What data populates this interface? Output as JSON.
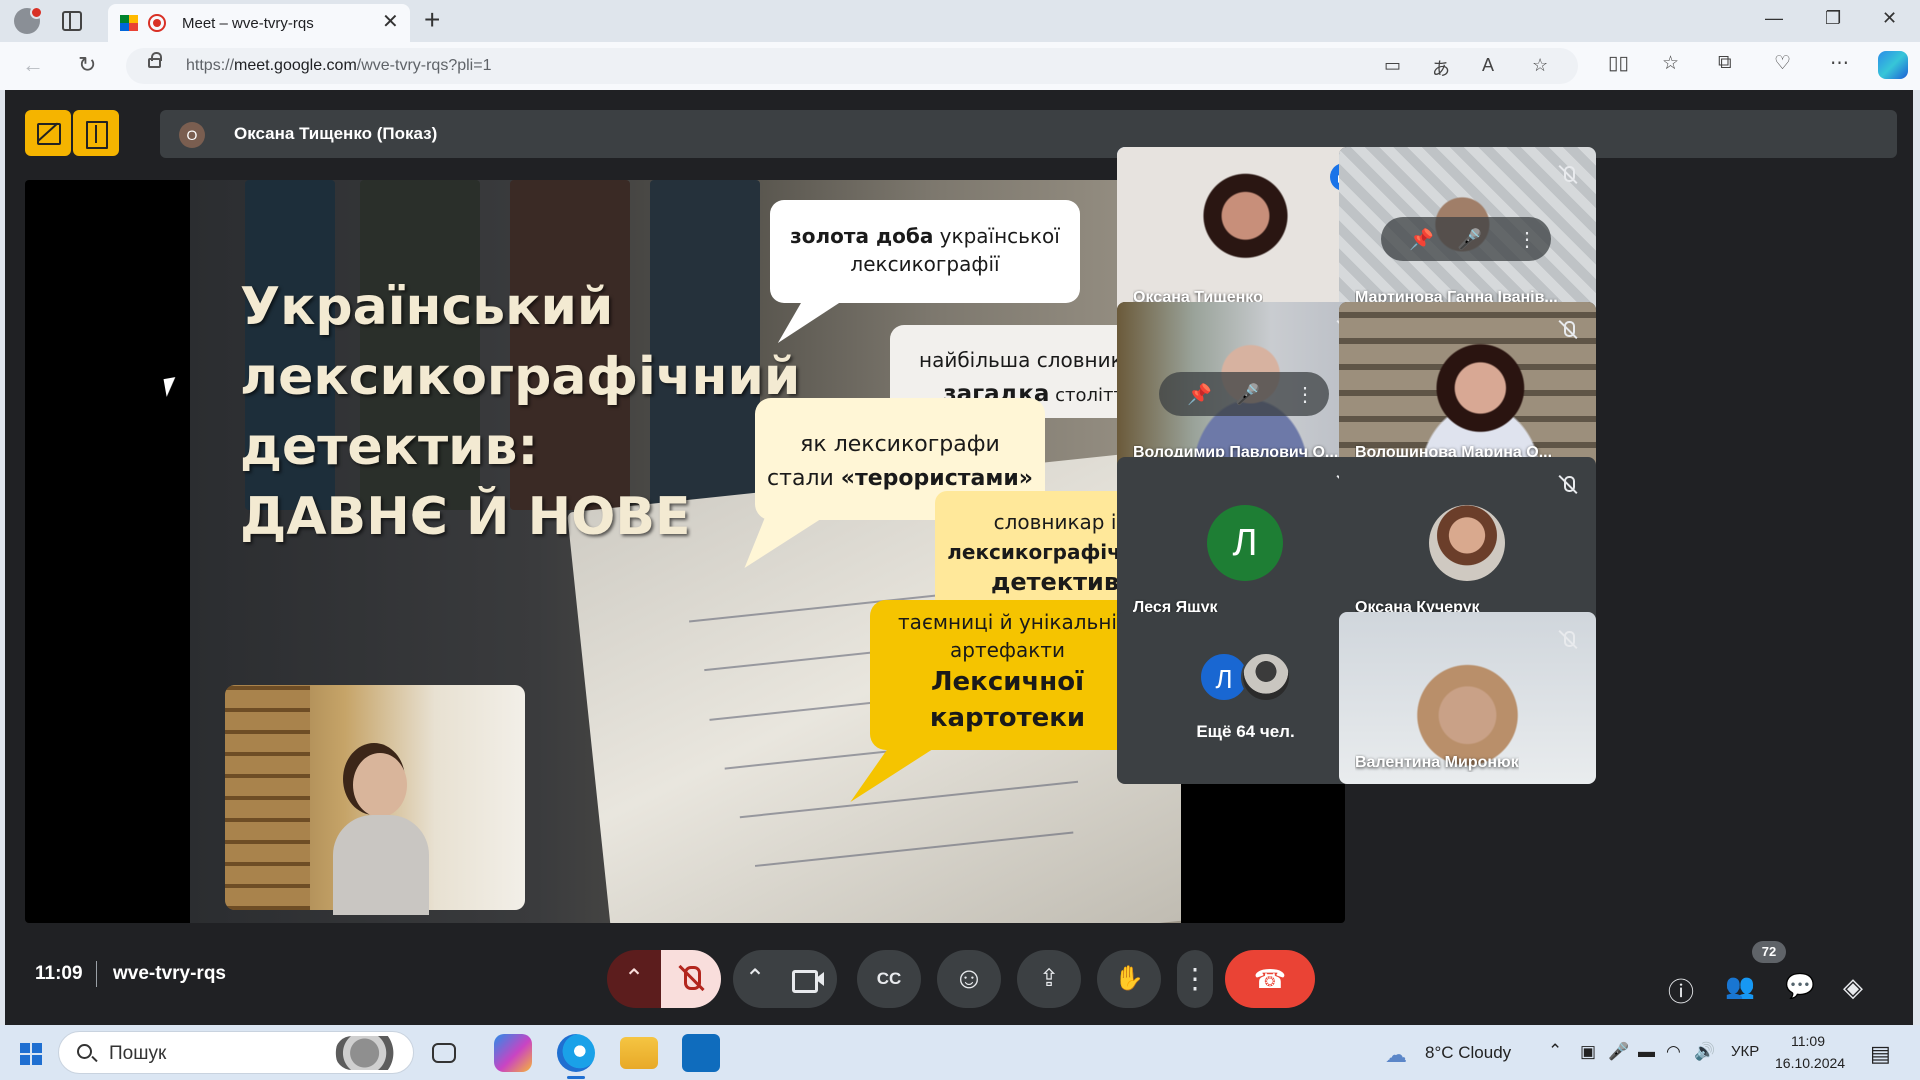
{
  "browser": {
    "tab_title": "Meet – wve-tvry-rqs",
    "tab_close_glyph": "✕",
    "new_tab_glyph": "+",
    "window_controls": [
      "—",
      "❐",
      "✕"
    ],
    "url_prefix": "https://",
    "url_host": "meet.google.com",
    "url_path": "/wve-tvry-rqs?pli=1",
    "nav": {
      "back": "←",
      "reload": "↻"
    },
    "toolbar_icons": [
      "camera-icon",
      "translate-icon",
      "read-aloud-icon",
      "favorite-star-icon",
      "split-screen-icon",
      "favorites-icon",
      "collections-icon",
      "browser-essentials-icon",
      "more-icon",
      "copilot-icon"
    ]
  },
  "meet": {
    "presenter_initial": "О",
    "presenter_label": "Оксана Тищенко (Показ)",
    "slide": {
      "title_lines": [
        "Український",
        "лексикографічний",
        "детектив:",
        "ДАВНЄ Й НОВЕ"
      ],
      "bubble1": {
        "bold": "золота доба",
        "rest1": " української",
        "line2": "лексикографії"
      },
      "bubble2": {
        "line1": "найбільша словникова",
        "bold": "загадка",
        "rest": " століття"
      },
      "bubble3": {
        "line1": "як лексикографи",
        "line2a": "стали ",
        "bold": "«терористами»"
      },
      "bubble4": {
        "line1": "словникар   і",
        "bold1": "лексикографічний",
        "bold2": "детектив"
      },
      "bubble5": {
        "line1": "таємниці й унікальні",
        "line2": "артефакти",
        "bold1": "Лексичної",
        "bold2": "картотеки"
      }
    },
    "tiles": [
      {
        "name": "Оксана Тищенко",
        "state": "speaking"
      },
      {
        "name": "Мартинова Ганна Іванів...",
        "state": "muted"
      },
      {
        "name": "Володимир Павлович О...",
        "state": "muted"
      },
      {
        "name": "Волошинова Марина О...",
        "state": "muted"
      },
      {
        "name": "Леся Ящук",
        "state": "muted",
        "initial": "Л",
        "avatar_color": "#1e7e34"
      },
      {
        "name": "Оксана Кучерук",
        "state": "muted"
      },
      {
        "more_initial": "Л",
        "more_label": "Ещё 64 чел."
      },
      {
        "name": "Валентина Миронюк",
        "state": "muted"
      }
    ],
    "hover_controls": {
      "pin": "📌",
      "mute": "🎤",
      "more": "⋮"
    },
    "bottom": {
      "time": "11:09",
      "meeting_code": "wve-tvry-rqs",
      "participants_badge": "72",
      "buttons": {
        "mic_options": "⌃",
        "cam_options": "⌃",
        "captions": "CC",
        "emoji": "☺",
        "present": "⇪",
        "raise_hand": "✋",
        "more": "⋮",
        "hangup": "☎"
      },
      "right_icons": {
        "info": "ⓘ",
        "people": "👥",
        "chat": "💬",
        "activities": "◈"
      }
    }
  },
  "taskbar": {
    "search_placeholder": "Пошук",
    "weather": "8°C  Cloudy",
    "language": "УКР",
    "clock_time": "11:09",
    "clock_date": "16.10.2024",
    "tray_icons": [
      "chevron-up-icon",
      "meet-now-icon",
      "microphone-icon",
      "battery-icon",
      "wifi-icon",
      "volume-icon",
      "notifications-icon"
    ]
  },
  "colors": {
    "meet_background": "#202124",
    "tile_background": "#3c4043",
    "accent_yellow": "#f5b400",
    "hangup_red": "#ea4335",
    "speaking_blue": "#1a73e8"
  }
}
